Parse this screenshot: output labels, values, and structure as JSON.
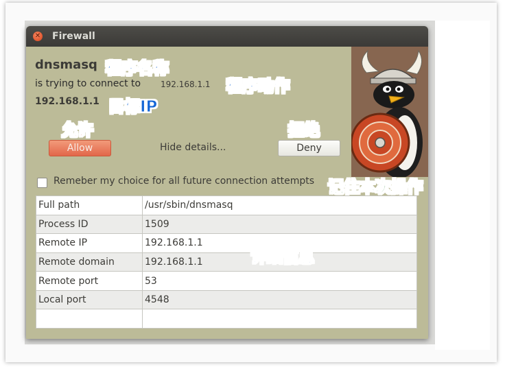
{
  "window": {
    "title": "Firewall"
  },
  "prompt": {
    "app_name": "dnsmasq",
    "action_text": "is trying to connect to",
    "action_ip": "192.168.1.1",
    "target_ip": "192.168.1.1"
  },
  "buttons": {
    "allow": "Allow",
    "hide_details": "Hide details...",
    "deny": "Deny"
  },
  "remember": {
    "label": "Remeber my choice for all future connection attempts",
    "checked": false
  },
  "details": {
    "rows": [
      {
        "key": "Full path",
        "value": "/usr/sbin/dnsmasq"
      },
      {
        "key": "Process ID",
        "value": "1509"
      },
      {
        "key": "Remote IP",
        "value": "192.168.1.1"
      },
      {
        "key": "Remote domain",
        "value": "192.168.1.1"
      },
      {
        "key": "Remote port",
        "value": "53"
      },
      {
        "key": "Local port",
        "value": "4548"
      },
      {
        "key": "",
        "value": ""
      }
    ]
  },
  "annotations": {
    "program_name": "程序名称",
    "program_action": "程序动作",
    "target_ip": "目标IP",
    "allow": "允许",
    "deny": "拒绝",
    "remember": "记住本次操作",
    "details": "详细信息"
  },
  "colors": {
    "allow_button": "#e2674a",
    "window_bg": "#bcbb98",
    "annotation_blue": "#1466d6",
    "annotation_red": "#e41414",
    "annotation_green": "#1a7e28"
  },
  "icons": {
    "close": "close-icon",
    "mascot": "penguin-viking-mascot-icon"
  }
}
